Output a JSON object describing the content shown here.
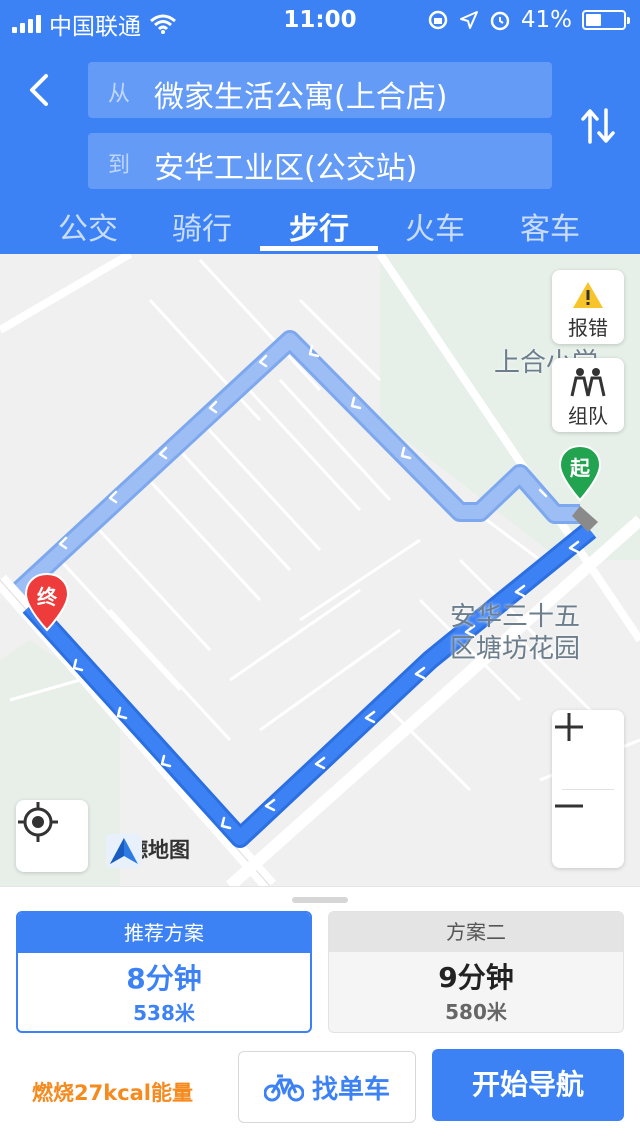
{
  "status": {
    "carrier": "中国联通",
    "time": "11:00",
    "battery": "41%",
    "battery_level": 0.41
  },
  "route": {
    "from_prefix": "从",
    "from": "微家生活公寓(上合店)",
    "to_prefix": "到",
    "to": "安华工业区(公交站)"
  },
  "tabs": [
    {
      "label": "公交"
    },
    {
      "label": "骑行"
    },
    {
      "label": "步行"
    },
    {
      "label": "火车"
    },
    {
      "label": "客车"
    }
  ],
  "map": {
    "report_label": "报错",
    "team_label": "组队",
    "poi_school": "上合小学",
    "poi_garden_line1": "安华三十五",
    "poi_garden_line2": "区塘坊花园",
    "start_label": "起",
    "end_label": "终",
    "brand": "高德地图",
    "colors": {
      "route": "#3d82f5",
      "route_alt": "#8fb5f7",
      "start": "#22a34f",
      "end": "#ee3b3b"
    }
  },
  "plans": [
    {
      "head": "推荐方案",
      "time": "8分钟",
      "distance": "538米"
    },
    {
      "head": "方案二",
      "time": "9分钟",
      "distance": "580米"
    }
  ],
  "calorie": "燃烧27kcal能量",
  "bike_label": "找单车",
  "nav_label": "开始导航"
}
